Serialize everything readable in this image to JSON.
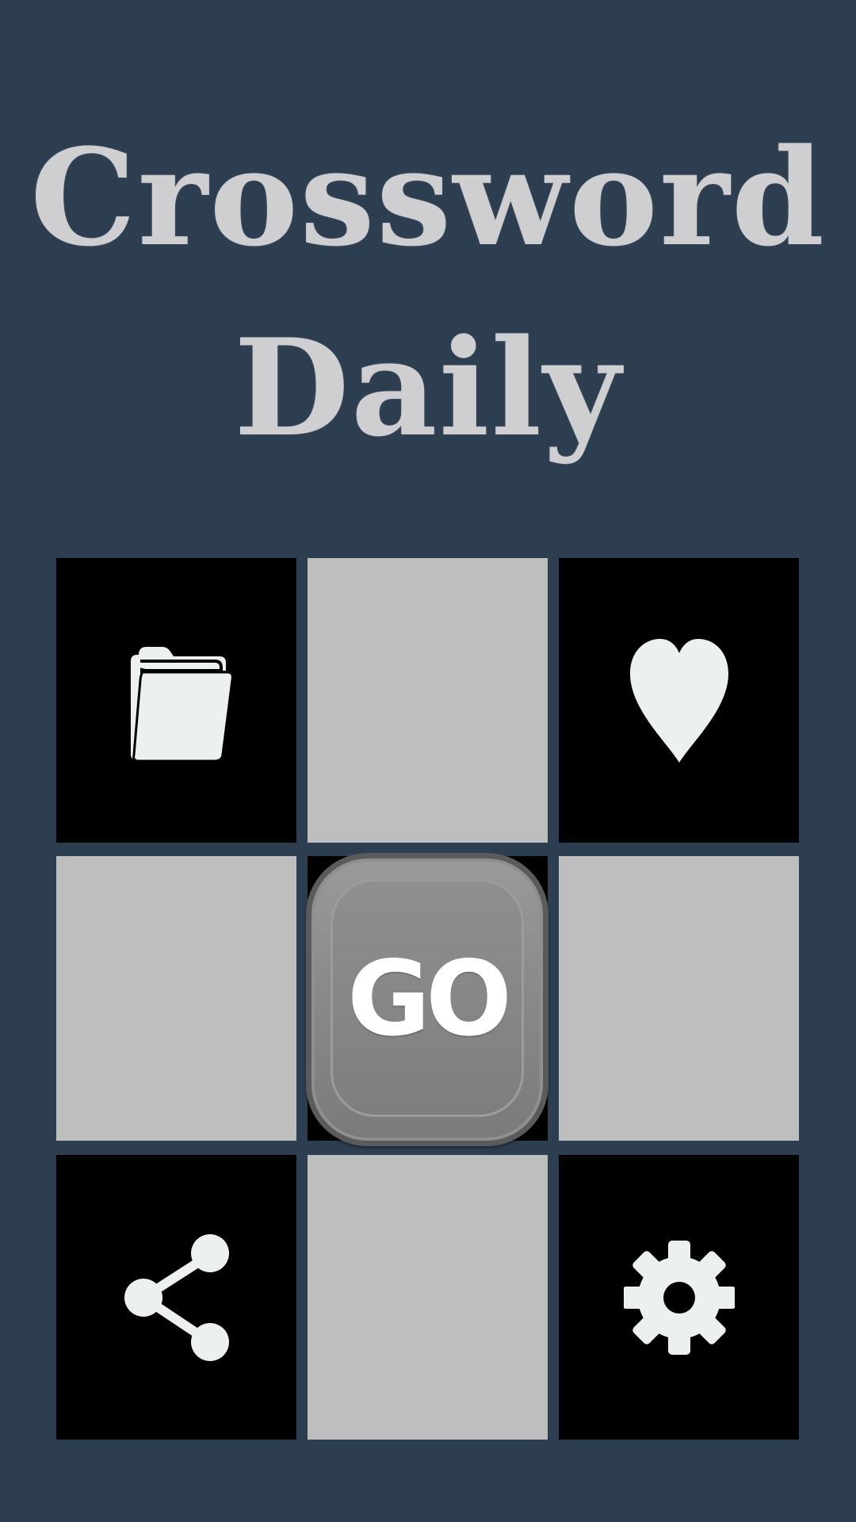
{
  "title": {
    "line1": "Crossword",
    "line2": "Daily"
  },
  "colors": {
    "background": "#2c3e50",
    "title": "#cfcfd1",
    "tile_dark": "#000000",
    "tile_light": "#bebebe",
    "icon": "#ecf0f1",
    "go_button": "#8a8a8a"
  },
  "grid": {
    "top_left_icon": "folder-icon",
    "top_right_icon": "heart-icon",
    "bottom_left_icon": "share-icon",
    "bottom_right_icon": "gear-icon"
  },
  "go_button": {
    "label": "GO"
  }
}
